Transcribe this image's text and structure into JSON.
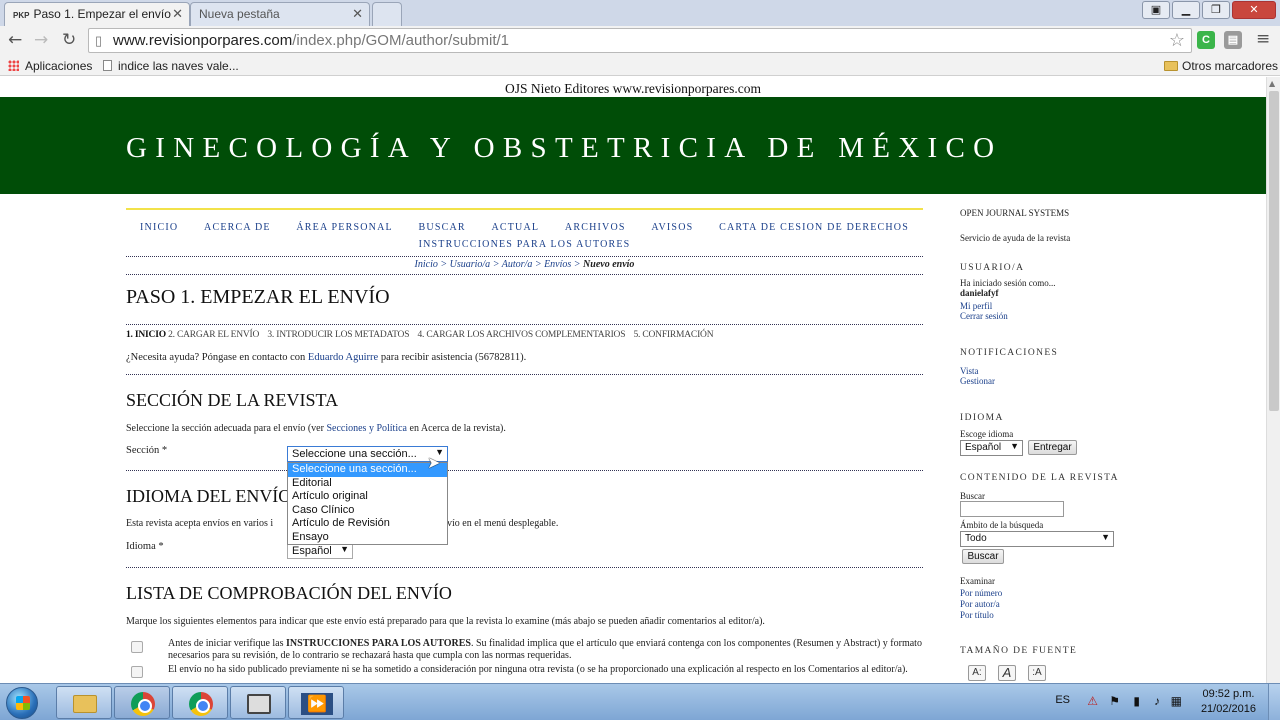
{
  "browser": {
    "tabs": [
      {
        "favicon": "PKP",
        "title": "Paso 1. Empezar el envío",
        "active": true
      },
      {
        "title": "Nueva pestaña",
        "active": false
      }
    ],
    "url_domain": "www.revisionporpares.com",
    "url_path": "/index.php/GOM/author/submit/1",
    "bookmarks": {
      "apps": "Aplicaciones",
      "item": "indice las naves vale...",
      "other": "Otros marcadores"
    }
  },
  "site": {
    "top_line": "OJS Nieto Editores www.revisionporpares.com",
    "journal_title": "GINECOLOGÍA Y OBSTETRICIA DE MÉXICO",
    "nav": [
      "INICIO",
      "ACERCA DE",
      "ÁREA PERSONAL",
      "BUSCAR",
      "ACTUAL",
      "ARCHIVOS",
      "AVISOS",
      "CARTA DE CESION DE DERECHOS",
      "INSTRUCCIONES PARA LOS AUTORES"
    ],
    "breadcrumb": [
      "Inicio",
      "Usuario/a",
      "Autor/a",
      "Envíos",
      "Nuevo envío"
    ]
  },
  "page": {
    "title": "PASO 1. EMPEZAR EL ENVÍO",
    "steps": [
      "1. INICIO",
      "2. CARGAR EL ENVÍO",
      "3. INTRODUCIR LOS METADATOS",
      "4. CARGAR LOS ARCHIVOS COMPLEMENTARIOS",
      "5. CONFIRMACIÓN"
    ],
    "help_pre": "¿Necesita ayuda? Póngase en contacto con ",
    "help_link": "Eduardo Aguirre",
    "help_post": " para recibir asistencia (56782811).",
    "section": {
      "heading": "SECCIÓN DE LA REVISTA",
      "instr_pre": "Seleccione la sección adecuada para el envío (ver ",
      "instr_link": "Secciones y Política",
      "instr_post": " en Acerca de la revista).",
      "label": "Sección *",
      "selected": "Seleccione una sección...",
      "options": [
        "Seleccione una sección...",
        "Editorial",
        "Artículo original",
        "Caso Clínico",
        "Artículo de Revisión",
        "Ensayo"
      ]
    },
    "language": {
      "heading": "IDIOMA DEL ENVÍO",
      "instr_left": "Esta revista acepta envíos en varios i",
      "instr_right": "nvío en el menú desplegable.",
      "label": "Idioma *",
      "selected": "Español"
    },
    "checklist": {
      "heading": "LISTA DE COMPROBACIÓN DEL ENVÍO",
      "instr": "Marque los siguientes elementos para indicar que este envío está preparado para que la revista lo examine (más abajo se pueden añadir comentarios al editor/a).",
      "items": [
        {
          "pre": "Antes de iniciar verifique las ",
          "bold": "INSTRUCCIONES PARA LOS AUTORES",
          "post": ". Su finalidad implica que el artículo que enviará contenga con los componentes (Resumen y Abstract) y formato necesarios para su revisión, de lo contrario se rechazará hasta que cumpla con las normas requeridas."
        },
        {
          "pre": "El envío no ha sido publicado previamente ni se ha sometido a consideración por ninguna otra revista (o se ha proporcionado una explicación al respecto en los Comentarios al editor/a).",
          "bold": "",
          "post": ""
        }
      ]
    }
  },
  "sidebar": {
    "ojs": "OPEN JOURNAL SYSTEMS",
    "help": "Servicio de ayuda de la revista",
    "user_heading": "USUARIO/A",
    "logged_as": "Ha iniciado sesión como...",
    "username": "danielafyf",
    "my_profile": "Mi perfil",
    "logout": "Cerrar sesión",
    "notif_heading": "NOTIFICACIONES",
    "notif_view": "Vista",
    "notif_manage": "Gestionar",
    "lang_heading": "IDIOMA",
    "lang_label": "Escoge idioma",
    "lang_selected": "Español",
    "lang_button": "Entregar",
    "content_heading": "CONTENIDO DE LA REVISTA",
    "search_label": "Buscar",
    "scope_label": "Ámbito de la búsqueda",
    "scope_selected": "Todo",
    "search_button": "Buscar",
    "browse_label": "Examinar",
    "by_number": "Por número",
    "by_author": "Por autor/a",
    "by_title": "Por título",
    "font_heading": "TAMAÑO DE FUENTE",
    "font_buttons": [
      "A:",
      "A",
      ":A"
    ]
  },
  "taskbar": {
    "lang": "ES",
    "time": "09:52 p.m.",
    "date": "21/02/2016"
  }
}
